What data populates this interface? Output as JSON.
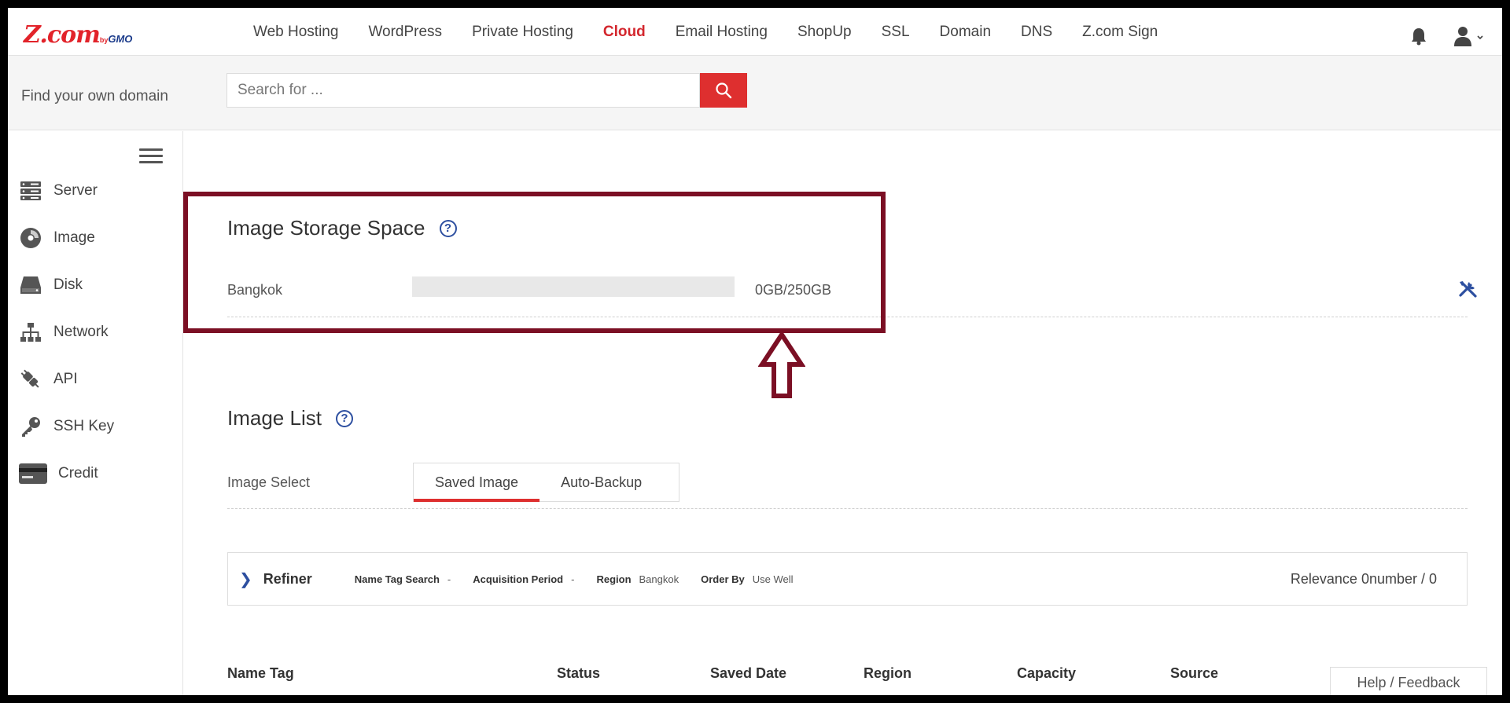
{
  "brand": {
    "logo_main": "Z.com",
    "logo_by": "by",
    "logo_gmo": "GMO",
    "accent_color": "#de2f2f"
  },
  "nav": {
    "links": [
      {
        "label": "Web Hosting"
      },
      {
        "label": "WordPress"
      },
      {
        "label": "Private Hosting"
      },
      {
        "label": "Cloud",
        "active": true
      },
      {
        "label": "Email Hosting"
      },
      {
        "label": "ShopUp"
      },
      {
        "label": "SSL"
      },
      {
        "label": "Domain"
      },
      {
        "label": "DNS"
      },
      {
        "label": "Z.com Sign"
      }
    ],
    "icons": [
      "bell-icon",
      "user-icon"
    ]
  },
  "search": {
    "label": "Find your own domain",
    "placeholder": "Search for ...",
    "value": ""
  },
  "sidebar": {
    "items": [
      {
        "label": "Server",
        "icon": "server-icon"
      },
      {
        "label": "Image",
        "icon": "disc-icon"
      },
      {
        "label": "Disk",
        "icon": "disk-icon"
      },
      {
        "label": "Network",
        "icon": "network-icon"
      },
      {
        "label": "API",
        "icon": "plug-icon"
      },
      {
        "label": "SSH Key",
        "icon": "key-icon"
      },
      {
        "label": "Credit",
        "icon": "credit-card-icon"
      }
    ]
  },
  "storage": {
    "title": "Image Storage Space",
    "region": "Bangkok",
    "usage_text": "0GB/250GB",
    "used_fraction": 0
  },
  "image_list": {
    "title": "Image List",
    "select_label": "Image Select",
    "tabs": [
      {
        "label": "Saved Image",
        "selected": true
      },
      {
        "label": "Auto-Backup"
      }
    ]
  },
  "refiner": {
    "title": "Refiner",
    "filters": [
      {
        "key": "Name Tag Search",
        "value": "-"
      },
      {
        "key": "Acquisition Period",
        "value": "-"
      },
      {
        "key": "Region",
        "value": "Bangkok"
      },
      {
        "key": "Order By",
        "value": "Use Well"
      }
    ],
    "relevance": "Relevance 0number / 0"
  },
  "table": {
    "headers": [
      "Name Tag",
      "Status",
      "Saved Date",
      "Region",
      "Capacity",
      "Source"
    ]
  },
  "feedback": "Help / Feedback"
}
